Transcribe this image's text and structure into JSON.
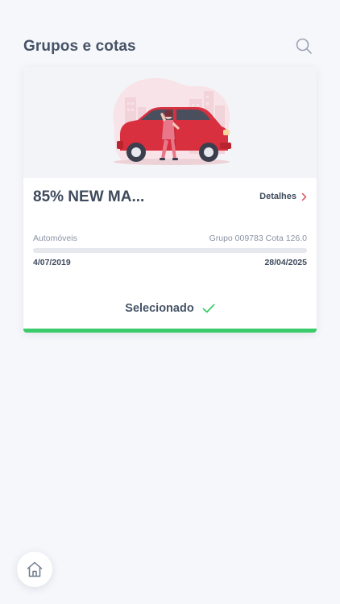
{
  "header": {
    "title": "Grupos e cotas",
    "search_icon": "search-icon"
  },
  "card": {
    "illustration": "woman-leaning-on-red-car-illustration",
    "name": "85% NEW MA...",
    "details_label": "Detalhes",
    "category": "Automóveis",
    "group_quota": "Grupo 009783 Cota 126.0",
    "start_date": "4/07/2019",
    "end_date": "28/04/2025",
    "progress_fraction": 0.0,
    "selected_label": "Selecionado",
    "colors": {
      "accent_green": "#3ccb6a",
      "car_red": "#d9303f",
      "details_chevron": "#e0485a"
    }
  },
  "nav": {
    "home_icon": "home-icon"
  }
}
